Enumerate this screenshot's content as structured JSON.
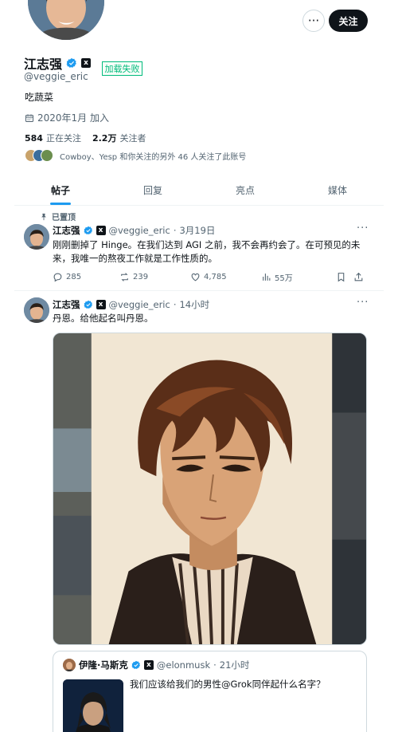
{
  "profile": {
    "display_name": "江志强",
    "handle": "@veggie_eric",
    "xai_badge": "x",
    "load_fail": "加载失败",
    "bio": "吃蔬菜",
    "joined": "2020年1月 加入",
    "following_count": "584",
    "following_label": "正在关注",
    "followers_count": "2.2万",
    "followers_label": "关注者",
    "followed_by": "Cowboy、Yesp 和你关注的另外 46 人关注了此账号",
    "follow_button": "关注",
    "more_button": "···"
  },
  "tabs": [
    {
      "label": "帖子",
      "active": true
    },
    {
      "label": "回复",
      "active": false
    },
    {
      "label": "亮点",
      "active": false
    },
    {
      "label": "媒体",
      "active": false
    }
  ],
  "posts": [
    {
      "pinned_label": "已置顶",
      "name": "江志强",
      "handle": "@veggie_eric",
      "time": "3月19日",
      "text_line1": "刚刚删掉了 Hinge。在我们达到 AGI 之前，我不会再约会了。在可预见的未",
      "text_line2": "来，我唯一的熬夜工作就是工作性质的。",
      "replies": "285",
      "reposts": "239",
      "likes": "4,785",
      "views": "55万"
    },
    {
      "name": "江志强",
      "handle": "@veggie_eric",
      "time": "14小时",
      "text": "丹恩。给他起名叫丹恩。",
      "quote": {
        "name": "伊隆·马斯克",
        "handle": "@elonmusk",
        "time": "21小时",
        "text": "我们应该给我们的男性@Grok同伴起什么名字？"
      }
    }
  ],
  "icons": {
    "verified": "verified-badge-icon",
    "calendar": "calendar-icon",
    "pin": "pin-icon",
    "reply": "reply-icon",
    "repost": "repost-icon",
    "like": "like-icon",
    "views": "views-icon",
    "bookmark": "bookmark-icon",
    "share": "share-icon"
  },
  "colors": {
    "accent": "#1d9bf0",
    "text": "#0f1419",
    "secondary": "#536471",
    "load_fail": "#00ba7c"
  }
}
